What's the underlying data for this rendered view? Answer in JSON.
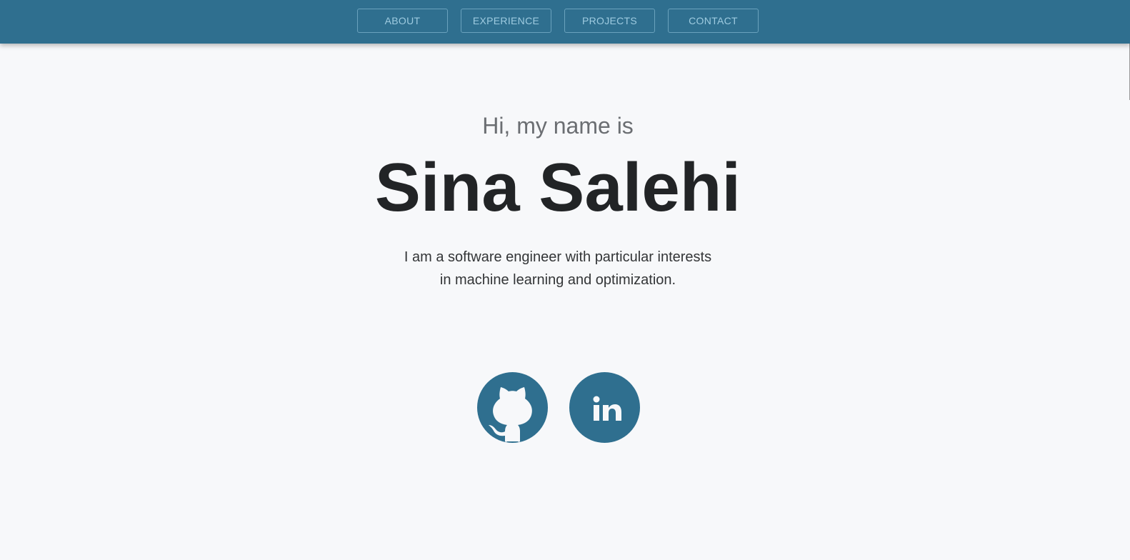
{
  "nav": {
    "items": [
      {
        "label": "ABOUT"
      },
      {
        "label": "EXPERIENCE"
      },
      {
        "label": "PROJECTS"
      },
      {
        "label": "CONTACT"
      }
    ]
  },
  "hero": {
    "greeting": "Hi, my name is",
    "name": "Sina Salehi",
    "bio_line1": "I am a software engineer with particular interests",
    "bio_line2": "in machine learning and optimization."
  },
  "social": {
    "linkedin_text": "in",
    "icons": [
      "github-icon",
      "linkedin-icon"
    ]
  },
  "colors": {
    "accent": "#2f6f8f",
    "background": "#f7f8fa",
    "nav_text": "#9ecbe0",
    "heading": "#222426"
  }
}
